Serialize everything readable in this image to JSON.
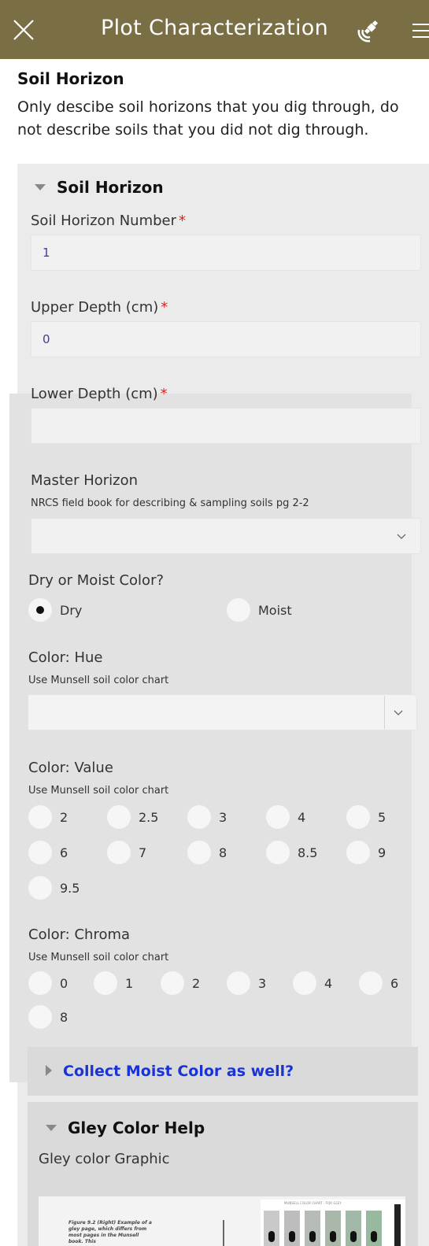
{
  "header": {
    "title": "Plot Characterization",
    "bg_color": "#7a6e45",
    "close_icon": "close-icon",
    "gps_icon": "satellite-gps-icon",
    "menu_icon": "menu-icon"
  },
  "section": {
    "title": "Soil Horizon",
    "description": "Only descibe soil horizons that you dig through, do not describe soils that you did not dig through."
  },
  "group": {
    "title": "Soil Horizon",
    "fields": {
      "horizon_number": {
        "label": "Soil Horizon Number",
        "required": "*",
        "value": "1"
      },
      "upper_depth": {
        "label": "Upper Depth (cm)",
        "required": "*",
        "value": "0"
      },
      "lower_depth": {
        "label": "Lower Depth (cm)",
        "required": "*",
        "value": ""
      },
      "master_horizon": {
        "label": "Master Horizon",
        "hint": "NRCS field book for describing & sampling soils pg 2-2",
        "value": ""
      }
    }
  },
  "color_type": {
    "label": "Dry or Moist Color?",
    "options": [
      "Dry",
      "Moist"
    ],
    "selected": "Dry"
  },
  "hue": {
    "label": "Color: Hue",
    "hint": "Use Munsell soil color chart",
    "value": ""
  },
  "value": {
    "label": "Color: Value",
    "hint": "Use Munsell soil color chart",
    "options": [
      "2",
      "2.5",
      "3",
      "4",
      "5",
      "6",
      "7",
      "8",
      "8.5",
      "9",
      "9.5"
    ]
  },
  "chroma": {
    "label": "Color: Chroma",
    "hint": "Use Munsell soil color chart",
    "options": [
      "0",
      "1",
      "2",
      "3",
      "4",
      "6",
      "8"
    ]
  },
  "moist_color": {
    "label": "Collect Moist Color as well?"
  },
  "gley": {
    "title": "Gley Color Help",
    "graphic_label": "Gley color Graphic"
  },
  "colors": {
    "accent_link": "#1a33d6",
    "required": "#d22222"
  }
}
